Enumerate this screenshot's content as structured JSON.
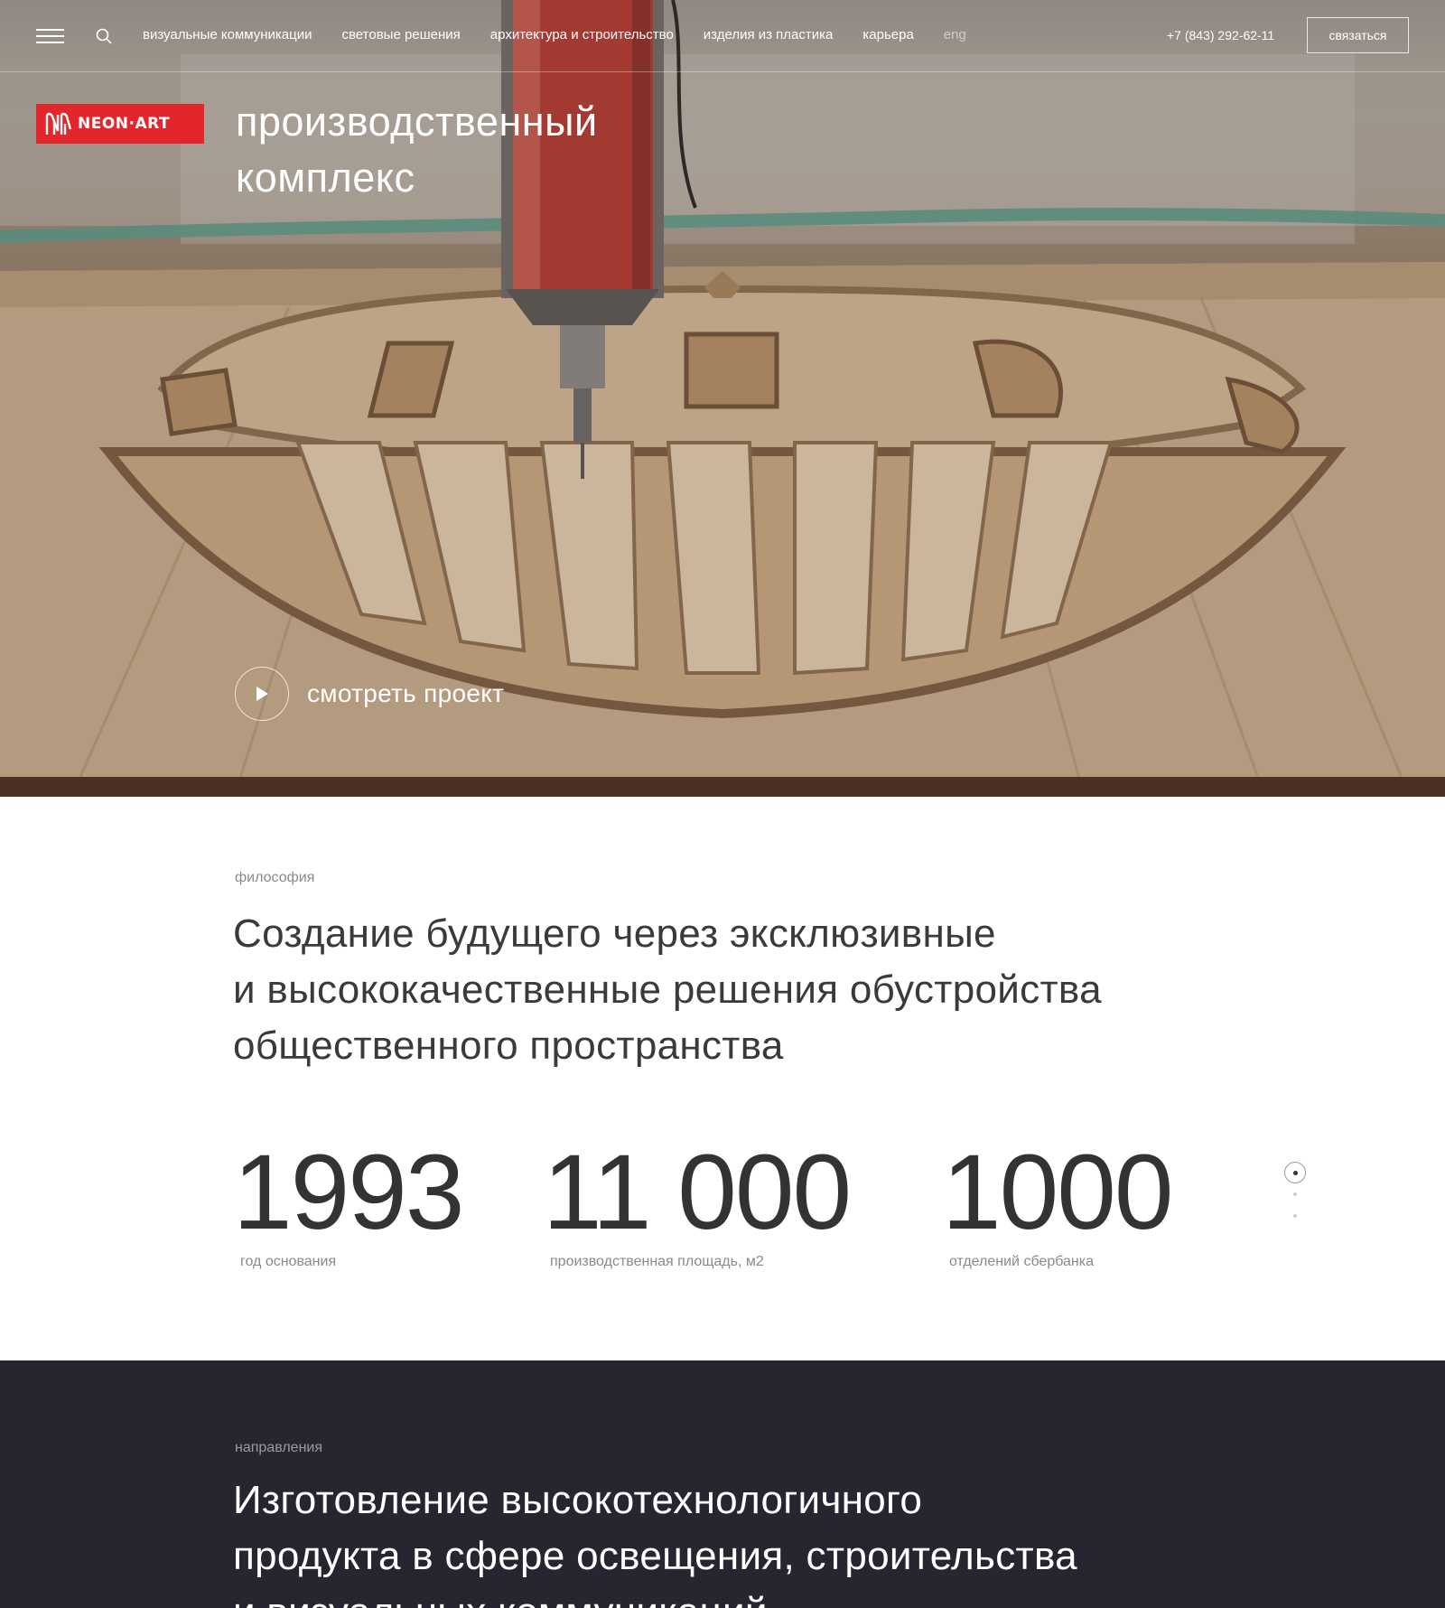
{
  "header": {
    "nav": [
      {
        "label": "визуальные коммуникации"
      },
      {
        "label": "световые решения"
      },
      {
        "label": "архитектура и строительство"
      },
      {
        "label": "изделия из пластика"
      },
      {
        "label": "карьера"
      },
      {
        "label": "eng"
      }
    ],
    "phone": "+7 (843) 292-62-11",
    "contact_label": "связаться"
  },
  "logo": {
    "text": "NEON·ART",
    "color": "#e3262b"
  },
  "hero": {
    "title_line1": "производственный",
    "title_line2": "комплекс",
    "watch_label": "смотреть проект"
  },
  "philosophy": {
    "kicker": "философия",
    "line1": "Создание будущего через эксклюзивные",
    "line2": "и высококачественные решения обустройства",
    "line3": "общественного пространства",
    "stats": [
      {
        "value": "1993",
        "label": "год основания"
      },
      {
        "value": "11 000",
        "label": "производственная площадь, м2"
      },
      {
        "value": "1000",
        "label": "отделений сбербанка"
      }
    ]
  },
  "directions": {
    "kicker": "направления",
    "line1": "Изготовление высокотехнологичного",
    "line2": "продукта в сфере освещения, строительства",
    "line3": "и визуальных коммуникаций"
  },
  "colors": {
    "dark_bg": "#272630",
    "accent": "#e3262b"
  }
}
